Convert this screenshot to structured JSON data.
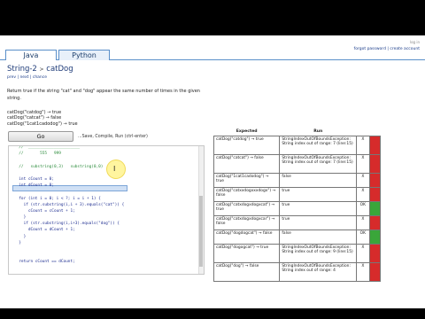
{
  "tabs": [
    {
      "label": "Java",
      "active": true
    },
    {
      "label": "Python",
      "active": false
    }
  ],
  "auth": {
    "top_text": "log in",
    "forgot_label": "forgot password",
    "separator": "|",
    "create_label": "create account"
  },
  "problem": {
    "section": "String-2",
    "separator": ">",
    "name": "catDog",
    "nav": {
      "prev": "prev",
      "sep1": "|",
      "next": "next",
      "sep2": "|",
      "chance": "chance"
    },
    "description": "Return true if the string \"cat\" and \"dog\" appear the same number of times in the given string.",
    "examples": [
      "catDog(\"catdog\") → true",
      "catDog(\"catcat\") → false",
      "catDog(\"1cat1cadodog\") → true"
    ]
  },
  "go": {
    "label": "Go",
    "hint": "...Save, Compile, Run (ctrl-enter)"
  },
  "code_lines": [
    {
      "text": "  //  ______________________",
      "comment": true
    },
    {
      "text": "  //       555   999",
      "comment": true
    },
    {
      "text": "",
      "comment": false
    },
    {
      "text": "  //   substring(0,3)   substring(0,0)",
      "comment": true
    },
    {
      "text": "",
      "comment": false
    },
    {
      "text": "  int cCount = 0;",
      "comment": false
    },
    {
      "text": "  int dCount = 0;",
      "comment": false
    },
    {
      "text": "",
      "comment": false
    },
    {
      "text": "  for (int i = 0; i < ?; i = i + 1) {",
      "comment": false
    },
    {
      "text": "    if (str.substring(i,i + 3).equals(\"cat\")) {",
      "comment": false
    },
    {
      "text": "      cCount = cCount + 1;",
      "comment": false
    },
    {
      "text": "    }",
      "comment": false
    },
    {
      "text": "    if (str.substring(i,i+3).equals(\"dog\")) {",
      "comment": false
    },
    {
      "text": "      dCount = dCount + 1;",
      "comment": false
    },
    {
      "text": "    }",
      "comment": false
    },
    {
      "text": "  }",
      "comment": false
    },
    {
      "text": "",
      "comment": false
    },
    {
      "text": "",
      "comment": false
    },
    {
      "text": "  return cCount == dCount;",
      "comment": false
    },
    {
      "text": "",
      "comment": false
    },
    {
      "text": "",
      "comment": false
    },
    {
      "text": "}",
      "comment": false
    }
  ],
  "results": {
    "headers": {
      "expected": "Expected",
      "run": "Run"
    },
    "rows": [
      {
        "expected": "catDog(\"catdog\") → true",
        "run": "StringIndexOutOfBoundsException: String index out of range: 7 (line:15)",
        "mark": "X",
        "color": "#d62b2b"
      },
      {
        "expected": "catDog(\"catcat\") → false",
        "run": "StringIndexOutOfBoundsException: String index out of range: 7 (line:15)",
        "mark": "X",
        "color": "#d62b2b"
      },
      {
        "expected": "catDog(\"1cat1cadodog\") → true",
        "run": "false",
        "mark": "X",
        "color": "#d62b2b"
      },
      {
        "expected": "catDog(\"catxxdogxxxdogx\") → false",
        "run": "true",
        "mark": "X",
        "color": "#d62b2b"
      },
      {
        "expected": "catDog(\"catxdogxdogxcat\") → true",
        "run": "true",
        "mark": "OK",
        "color": "#3aa63a"
      },
      {
        "expected": "catDog(\"catxdogxdogxcar\") → false",
        "run": "true",
        "mark": "X",
        "color": "#d62b2b"
      },
      {
        "expected": "catDog(\"dogdogcat\") → false",
        "run": "false",
        "mark": "OK",
        "color": "#3aa63a"
      },
      {
        "expected": "catDog(\"dogogcat\") → true",
        "run": "StringIndexOutOfBoundsException: String index out of range: 9 (line:15)",
        "mark": "X",
        "color": "#d62b2b"
      },
      {
        "expected": "catDog(\"dog\") → false",
        "run": "StringIndexOutOfBoundsException: String index out of range: 4",
        "mark": "X",
        "color": "#d62b2b"
      }
    ]
  }
}
